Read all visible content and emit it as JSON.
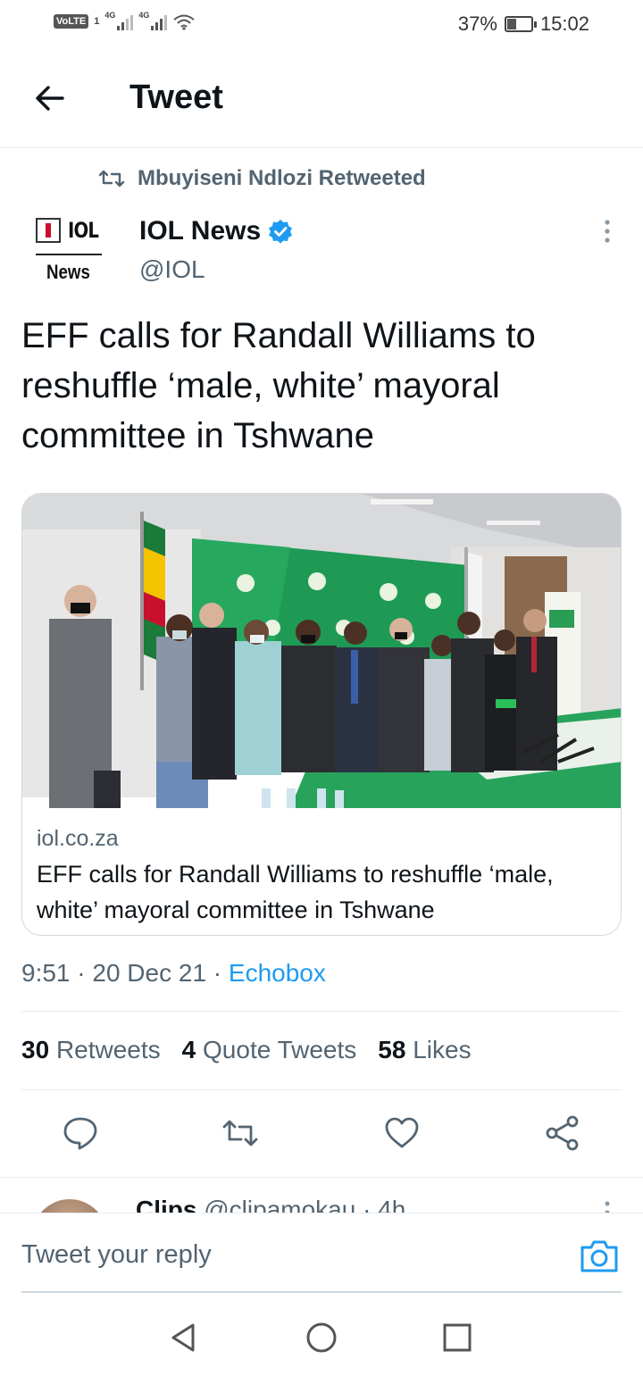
{
  "status_bar": {
    "volte": "VoLTE",
    "sim": "1",
    "network1": "4G",
    "network2": "4G",
    "battery_pct": "37%",
    "battery_level": 0.37,
    "time": "15:02"
  },
  "header": {
    "title": "Tweet",
    "back_icon": "arrow-left-icon"
  },
  "retweet_context": {
    "label": "Mbuyiseni Ndlozi Retweeted",
    "icon": "retweet-icon"
  },
  "author": {
    "avatar_text_top": "IOL",
    "avatar_text_bottom": "News",
    "name": "IOL News",
    "handle": "@IOL",
    "verified": true
  },
  "tweet": {
    "text": "EFF calls for Randall Williams to reshuffle ‘male, white’ mayoral committee in Tshwane",
    "timestamp": "9:51 · 20 Dec 21 · ",
    "source": "Echobox"
  },
  "card": {
    "domain": "iol.co.za",
    "title": "EFF calls for Randall Williams to reshuffle ‘male, white’ mayoral committee in Tshwane"
  },
  "stats": {
    "retweets_count": "30",
    "retweets_label": "Retweets",
    "quotes_count": "4",
    "quotes_label": "Quote Tweets",
    "likes_count": "58",
    "likes_label": "Likes"
  },
  "actions": [
    "reply-icon",
    "retweet-icon",
    "like-icon",
    "share-icon"
  ],
  "next_reply": {
    "name": "Clips",
    "handle_time": "@clipamokau · 4h"
  },
  "reply_bar": {
    "placeholder": "Tweet your reply"
  },
  "colors": {
    "accent": "#1d9bf0",
    "text_primary": "#0f1419",
    "text_secondary": "#536471",
    "divider": "#e6ecf0"
  }
}
